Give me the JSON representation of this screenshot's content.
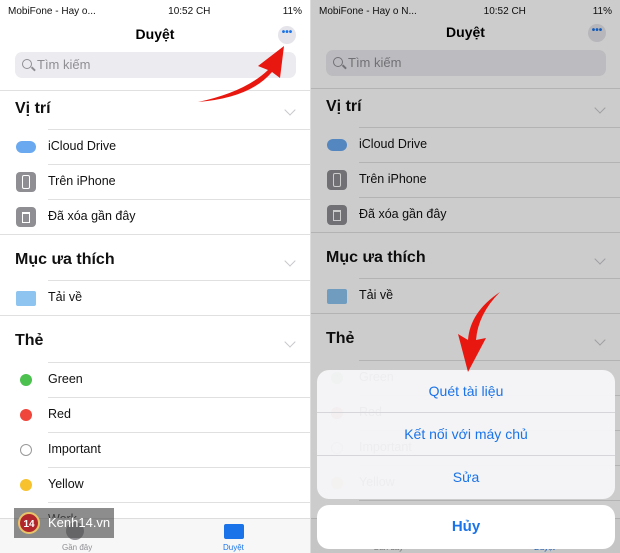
{
  "status_left": {
    "carrier": "MobiFone - Hay o...",
    "time": "10:52 CH",
    "battery": "11%"
  },
  "status_right": {
    "carrier": "MobiFone - Hay o N...",
    "time": "10:52 CH",
    "battery": "11%"
  },
  "header": {
    "title": "Duyệt",
    "more_label": "•••"
  },
  "search": {
    "placeholder": "Tìm kiếm"
  },
  "sections": {
    "locations": {
      "title": "Vị trí",
      "items": [
        {
          "label": "iCloud Drive",
          "icon": "cloud-icon"
        },
        {
          "label": "Trên iPhone",
          "icon": "iphone-icon"
        },
        {
          "label": "Đã xóa gần đây",
          "icon": "trash-icon"
        }
      ]
    },
    "favorites": {
      "title": "Mục ưa thích",
      "items": [
        {
          "label": "Tải về",
          "icon": "folder-download-icon"
        }
      ]
    },
    "tags": {
      "title": "Thẻ",
      "items": [
        {
          "label": "Green",
          "color": "#4cc14f"
        },
        {
          "label": "Red",
          "color": "#f0453a"
        },
        {
          "label": "Important",
          "color": ""
        },
        {
          "label": "Yellow",
          "color": "#f7c22d"
        },
        {
          "label": "Work",
          "color": ""
        }
      ]
    }
  },
  "tabbar": {
    "recent": "Gần đây",
    "browse": "Duyệt"
  },
  "action_sheet": {
    "items": [
      "Quét tài liệu",
      "Kết nối với máy chủ",
      "Sửa"
    ],
    "cancel": "Hủy"
  },
  "watermark": {
    "logo": "14",
    "text": "Kenh14.vn"
  },
  "colors": {
    "accent": "#1a73e8",
    "arrow": "#e8170f"
  }
}
